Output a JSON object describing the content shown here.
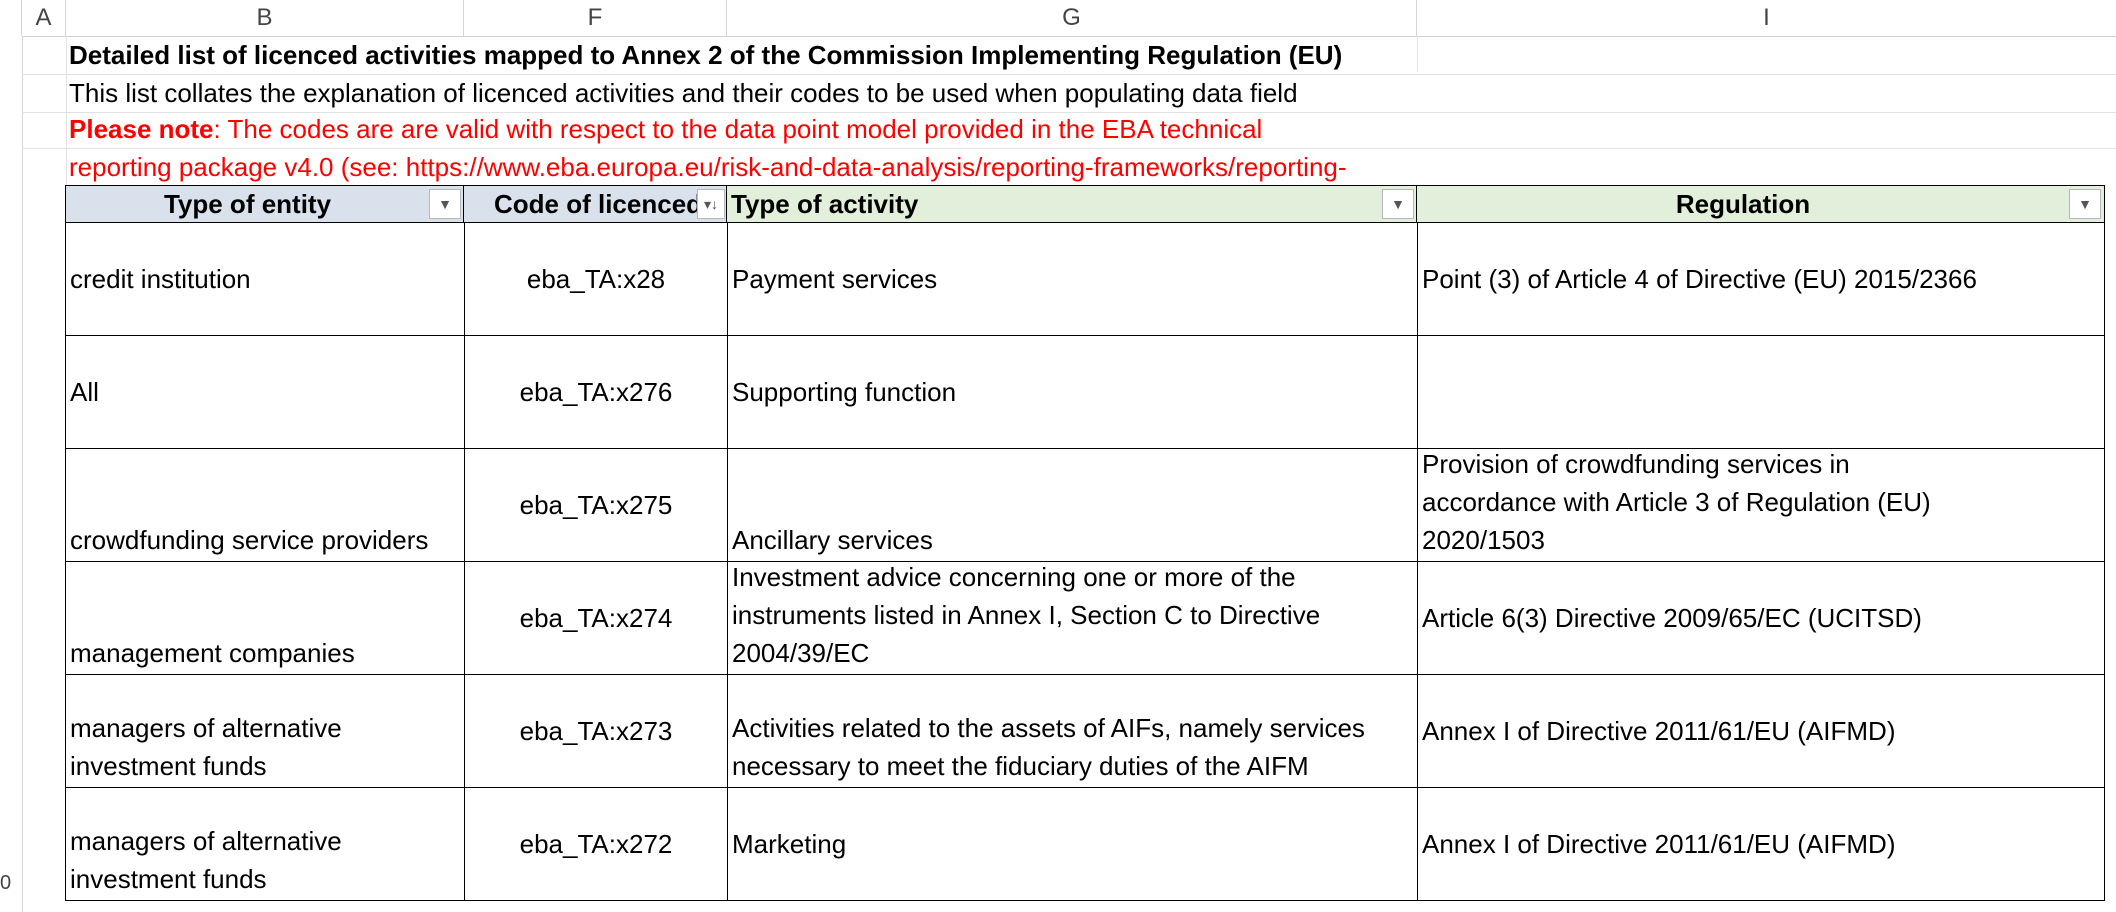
{
  "columns": [
    "A",
    "B",
    "F",
    "G",
    "I"
  ],
  "row_numbers": [
    "0"
  ],
  "title": {
    "heading": "Detailed list of licenced activities mapped to Annex 2 of the Commission Implementing Regulation (EU)",
    "description": "This list collates the explanation of licenced activities and their codes to be used when populating data field",
    "note_label": "Please note",
    "note_line1": ": The codes are are valid  with respect to the data point model provided in the EBA technical",
    "note_line2": "reporting package v4.0 (see: https://www.eba.europa.eu/risk-and-data-analysis/reporting-frameworks/reporting-"
  },
  "table": {
    "headers": [
      "Type of entity",
      "Code of licenced",
      "Type of activity",
      "Regulation"
    ],
    "rows": [
      {
        "entity": [
          "credit institution"
        ],
        "code": "eba_TA:x28",
        "activity": [
          "Payment services"
        ],
        "regulation": [
          "Point (3) of Article 4 of Directive (EU) 2015/2366"
        ]
      },
      {
        "entity": [
          "All"
        ],
        "code": "eba_TA:x276",
        "activity": [
          "Supporting function"
        ],
        "regulation": []
      },
      {
        "entity": [
          "crowdfunding service providers"
        ],
        "code": "eba_TA:x275",
        "activity": [
          "Ancillary services"
        ],
        "regulation": [
          "Provision of crowdfunding services in",
          "accordance with Article 3 of Regulation (EU)",
          "2020/1503"
        ]
      },
      {
        "entity": [
          "management companies"
        ],
        "code": "eba_TA:x274",
        "activity": [
          "Investment advice concerning one or more of the",
          "instruments listed in Annex I, Section C to Directive",
          "2004/39/EC"
        ],
        "regulation": [
          "Article 6(3) Directive 2009/65/EC (UCITSD)"
        ]
      },
      {
        "entity": [
          "managers of alternative",
          "investment funds"
        ],
        "code": "eba_TA:x273",
        "activity": [
          "Activities related to the assets of AIFs, namely services",
          "necessary to meet the fiduciary duties of the AIFM"
        ],
        "regulation": [
          "Annex I of Directive 2011/61/EU (AIFMD)"
        ]
      },
      {
        "entity": [
          "managers of alternative",
          "investment funds"
        ],
        "code": "eba_TA:x272",
        "activity": [
          "Marketing"
        ],
        "regulation": [
          "Annex I of Directive 2011/61/EU (AIFMD)"
        ]
      }
    ]
  },
  "colors": {
    "header_entity_bg": "#d9e1ec",
    "header_code_bg": "#d9e1ec",
    "header_activity_bg": "#e2efda",
    "header_regulation_bg": "#e2efda",
    "note_text": "#ff0000"
  }
}
